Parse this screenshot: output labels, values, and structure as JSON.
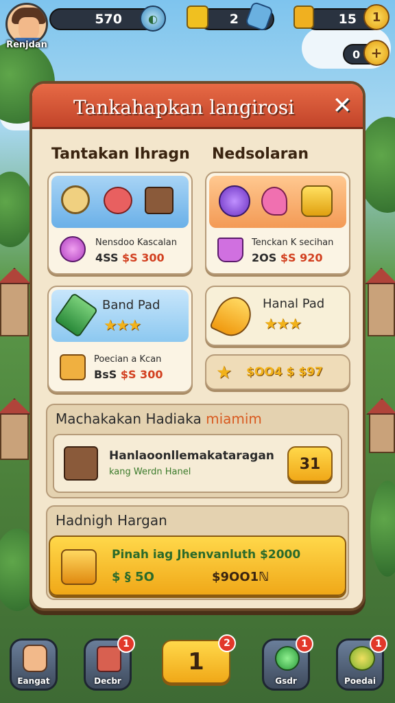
{
  "hud": {
    "player_name": "Renjdan",
    "resource_1": "570",
    "resource_2": "2",
    "resource_3": "15",
    "coins_secondary": "0"
  },
  "panel": {
    "title": "Tankahapkan langirosi",
    "col_left_title": "Tantakan Ihragn",
    "col_right_title": "Nedsolaran",
    "card_1": {
      "line": "Nensdoo Kascalan",
      "price_prefix": "4SS",
      "price": "$S 300"
    },
    "card_2": {
      "line": "Tenckan K secihan",
      "price_prefix": "2OS",
      "price": "$S 920"
    },
    "card_3": {
      "title": "Band Pad",
      "line": "Poecian a Kcan",
      "price_prefix": "BsS",
      "price": "$S 300",
      "stars": "★★★"
    },
    "card_4": {
      "title": "Hanal Pad",
      "stars": "★★★"
    },
    "card_5": {
      "price": "$OO4 $ $97"
    },
    "section_1": {
      "title_main": "Machakakan Hadiaka ",
      "title_highlight": "miamim",
      "item_title": "Hanlaoonllemakataragan",
      "item_sub": "kang Werdn Hanel",
      "button": "31"
    },
    "section_2": {
      "title": "Hadnigh Hargan",
      "line": "Pinah iag Jhenvanluth $2000",
      "price_left": "$ § 5O",
      "price_right": "$9OO1ℕ"
    }
  },
  "nav": {
    "items": [
      {
        "label": "Eangat",
        "badge": ""
      },
      {
        "label": "Decbr",
        "badge": "1"
      },
      {
        "label": "",
        "badge": "2",
        "center": "1"
      },
      {
        "label": "Gsdr",
        "badge": "1"
      },
      {
        "label": "Poedai",
        "badge": "1"
      }
    ]
  },
  "colors": {
    "header": "#d85435",
    "panel": "#f3e6cc",
    "accent_yellow": "#f5c02a",
    "badge_red": "#e2382a"
  }
}
